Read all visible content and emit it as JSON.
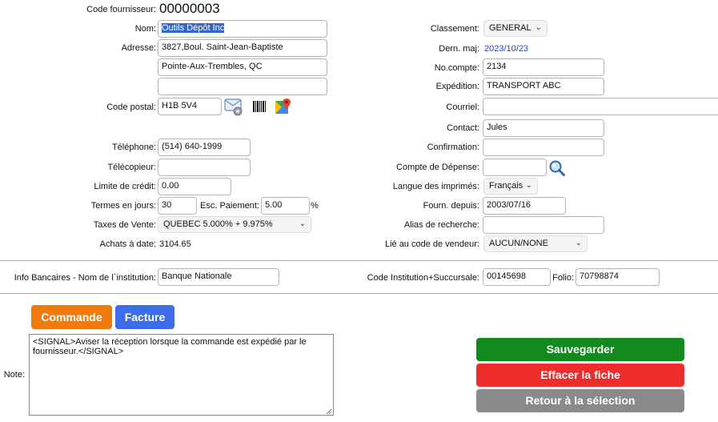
{
  "left": {
    "supplier_code": {
      "label": "Code fournisseur:",
      "value": "00000003"
    },
    "name": {
      "label": "Nom:",
      "value": "Outils Dépôt Inc"
    },
    "address": {
      "label": "Adresse:",
      "line1": "3827,Boul. Saint-Jean-Baptiste",
      "line2": "Pointe-Aux-Trembles, QC",
      "line3": ""
    },
    "postal": {
      "label": "Code postal:",
      "value": "H1B 5V4"
    },
    "phone": {
      "label": "Téléphone:",
      "value": "(514) 640-1999"
    },
    "fax": {
      "label": "Télécopieur:",
      "value": ""
    },
    "credit": {
      "label": "Limite de crédit:",
      "value": "0.00"
    },
    "terms": {
      "label": "Termes en jours:",
      "value": "30"
    },
    "discount": {
      "label": "Esc. Paiement:",
      "value": "5.00",
      "unit": "%"
    },
    "tax": {
      "label": "Taxes de Vente:",
      "value": "QUEBEC 5.000% + 9.975%"
    },
    "purchases": {
      "label": "Achats à date:",
      "value": "3104.65"
    }
  },
  "right": {
    "classification": {
      "label": "Classement:",
      "value": "GENERAL"
    },
    "last_update": {
      "label": "Dern. maj:",
      "value": "2023/10/23"
    },
    "account": {
      "label": "No.compte:",
      "value": "2134"
    },
    "shipping": {
      "label": "Expédition:",
      "value": "TRANSPORT ABC"
    },
    "email": {
      "label": "Courriel:",
      "value": ""
    },
    "contact": {
      "label": "Contact:",
      "value": "Jules"
    },
    "confirmation": {
      "label": "Confirmation:",
      "value": ""
    },
    "expense_account": {
      "label": "Compte de Dépense:",
      "value": ""
    },
    "print_lang": {
      "label": "Langue des imprimés:",
      "value": "Français"
    },
    "supplier_since": {
      "label": "Fourn. depuis:",
      "value": "2003/07/16"
    },
    "search_alias": {
      "label": "Alias de recherche:",
      "value": ""
    },
    "vendor_code": {
      "label": "Lié au code de vendeur:",
      "value": "AUCUN/NONE"
    }
  },
  "bank": {
    "institution_label": "Info Bancaires - Nom de l`institution:",
    "institution_value": "Banque Nationale",
    "transit_label": "Code Institution+Succursale:",
    "transit_value": "00145698",
    "folio_label": "Folio:",
    "folio_value": "70798874"
  },
  "buttons": {
    "order": "Commande",
    "invoice": "Facture",
    "save": "Sauvegarder",
    "delete": "Effacer la fiche",
    "back": "Retour à la sélection"
  },
  "note": {
    "label": "Note:",
    "value": "<SIGNAL>Aviser la réception lorsque la commande est expédié par le fournisseur.</SIGNAL>"
  },
  "colors": {
    "order_btn": "#f07b0c",
    "invoice_btn": "#3b6ee8",
    "save_btn": "#138a1e",
    "delete_btn": "#ee2c2c",
    "back_btn": "#8a8a8a",
    "date_link": "#2244cc",
    "name_highlight": "#3366cc"
  },
  "icons": [
    "email-icon",
    "barcode-icon",
    "map-icon",
    "search-icon"
  ]
}
